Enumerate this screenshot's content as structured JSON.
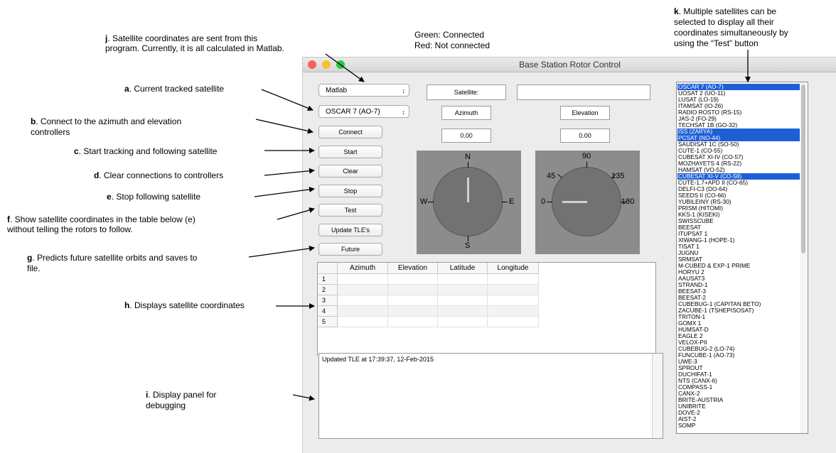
{
  "annotations": {
    "j": {
      "key": "j",
      "text": ". Satellite coordinates are sent from this",
      "text2": "program. Currently, it is all calculated in Matlab."
    },
    "legend_green": "Green: Connected",
    "legend_red": "Red: Not connected",
    "k": {
      "key": "k",
      "text": ". Multiple satellites can be",
      "text2": "selected to display all their",
      "text3": "coordinates simultaneously by",
      "text4": "using the “Test” button"
    },
    "a": {
      "key": "a",
      "text": ". Current tracked satellite"
    },
    "b": {
      "key": "b",
      "text": ". Connect to the azimuth and elevation",
      "text2": "controllers"
    },
    "c": {
      "key": "c",
      "text": ". Start tracking and following satellite"
    },
    "d": {
      "key": "d",
      "text": ". Clear connections to controllers"
    },
    "e": {
      "key": "e",
      "text": ". Stop following satellite"
    },
    "f": {
      "key": "f",
      "text": ". Show satellite coordinates in the table below (e)",
      "text2": "without telling the rotors to follow."
    },
    "g": {
      "key": "g",
      "text": ". Predicts future satellite orbits and saves to",
      "text2": "file."
    },
    "h": {
      "key": "h",
      "text": ". Displays satellite coordinates"
    },
    "i": {
      "key": "i",
      "text": ". Display panel for",
      "text2": "debugging"
    }
  },
  "window": {
    "title": "Base Station Rotor Control",
    "source_select": "Matlab",
    "satellite_select": "OSCAR 7 (AO-7)",
    "satellite_label": "Satellite:",
    "satellite_value": "",
    "azimuth_label": "Azimuth",
    "elevation_label": "Elevation",
    "azimuth_value": "0.00",
    "elevation_value": "0.00",
    "buttons": {
      "connect": "Connect",
      "start": "Start",
      "clear": "Clear",
      "stop": "Stop",
      "test": "Test",
      "update": "Update TLE's",
      "future": "Future"
    },
    "compass": {
      "n": "N",
      "e": "E",
      "s": "S",
      "w": "W",
      "heading": 0
    },
    "elevation_dial": {
      "l0": "0",
      "l45": "45",
      "l90": "90",
      "l135": "135",
      "l180": "180",
      "value": 0
    },
    "table": {
      "columns": [
        "Azimuth",
        "Elevation",
        "Latitude",
        "Longitude"
      ],
      "rows": [
        "1",
        "2",
        "3",
        "4",
        "5"
      ]
    },
    "debug_text": "Updated TLE at 17:39:37, 12-Feb-2015",
    "satellites": [
      {
        "name": "OSCAR 7 (AO-7)",
        "selected": true
      },
      {
        "name": "UOSAT 2 (UO-11)",
        "selected": false
      },
      {
        "name": "LUSAT (LO-19)",
        "selected": false
      },
      {
        "name": "ITAMSAT (IO-26)",
        "selected": false
      },
      {
        "name": "RADIO ROSTO (RS-15)",
        "selected": false
      },
      {
        "name": "JAS-2 (FO-29)",
        "selected": false
      },
      {
        "name": "TECHSAT 1B (GO-32)",
        "selected": false
      },
      {
        "name": "ISS (ZARYA)",
        "selected": true
      },
      {
        "name": "PCSAT (NO-44)",
        "selected": true
      },
      {
        "name": "SAUDISAT 1C (SO-50)",
        "selected": false
      },
      {
        "name": "CUTE-1 (CO-55)",
        "selected": false
      },
      {
        "name": "CUBESAT XI-IV (CO-57)",
        "selected": false
      },
      {
        "name": "MOZHAYETS 4 (RS-22)",
        "selected": false
      },
      {
        "name": "HAMSAT (VO-52)",
        "selected": false
      },
      {
        "name": "CUBESAT XI-V (CO-58)",
        "selected": true
      },
      {
        "name": "CUTE-1.7+APD II (CO-65)",
        "selected": false
      },
      {
        "name": "DELFI-C3 (DO-64)",
        "selected": false
      },
      {
        "name": "SEEDS II (CO-66)",
        "selected": false
      },
      {
        "name": "YUBILEINY (RS-30)",
        "selected": false
      },
      {
        "name": "PRISM (HITOMI)",
        "selected": false
      },
      {
        "name": "KKS-1 (KISEKI)",
        "selected": false
      },
      {
        "name": "SWISSCUBE",
        "selected": false
      },
      {
        "name": "BEESAT",
        "selected": false
      },
      {
        "name": "ITUPSAT 1",
        "selected": false
      },
      {
        "name": "XIWANG-1 (HOPE-1)",
        "selected": false
      },
      {
        "name": "TISAT 1",
        "selected": false
      },
      {
        "name": "JUGNU",
        "selected": false
      },
      {
        "name": "SRMSAT",
        "selected": false
      },
      {
        "name": "M-CUBED & EXP-1 PRIME",
        "selected": false
      },
      {
        "name": "HORYU 2",
        "selected": false
      },
      {
        "name": "AAUSAT3",
        "selected": false
      },
      {
        "name": "STRAND-1",
        "selected": false
      },
      {
        "name": "BEESAT-3",
        "selected": false
      },
      {
        "name": "BEESAT-2",
        "selected": false
      },
      {
        "name": "CUBEBUG-1 (CAPITAN BETO)",
        "selected": false
      },
      {
        "name": "ZACUBE-1 (TSHEPISOSAT)",
        "selected": false
      },
      {
        "name": "TRITON-1",
        "selected": false
      },
      {
        "name": "GOMX 1",
        "selected": false
      },
      {
        "name": "HUMSAT-D",
        "selected": false
      },
      {
        "name": "EAGLE 2",
        "selected": false
      },
      {
        "name": "VELOX-PII",
        "selected": false
      },
      {
        "name": "CUBEBUG-2 (LO-74)",
        "selected": false
      },
      {
        "name": "FUNCUBE-1 (AO-73)",
        "selected": false
      },
      {
        "name": "UWE-3",
        "selected": false
      },
      {
        "name": "SPROUT",
        "selected": false
      },
      {
        "name": "DUCHIFAT-1",
        "selected": false
      },
      {
        "name": "NTS (CANX-6)",
        "selected": false
      },
      {
        "name": "COMPASS-1",
        "selected": false
      },
      {
        "name": "CANX-2",
        "selected": false
      },
      {
        "name": "BRITE-AUSTRIA",
        "selected": false
      },
      {
        "name": "UNIBRITE",
        "selected": false
      },
      {
        "name": "DOVE-2",
        "selected": false
      },
      {
        "name": "AIST-2",
        "selected": false
      },
      {
        "name": "SOMP",
        "selected": false
      }
    ]
  }
}
